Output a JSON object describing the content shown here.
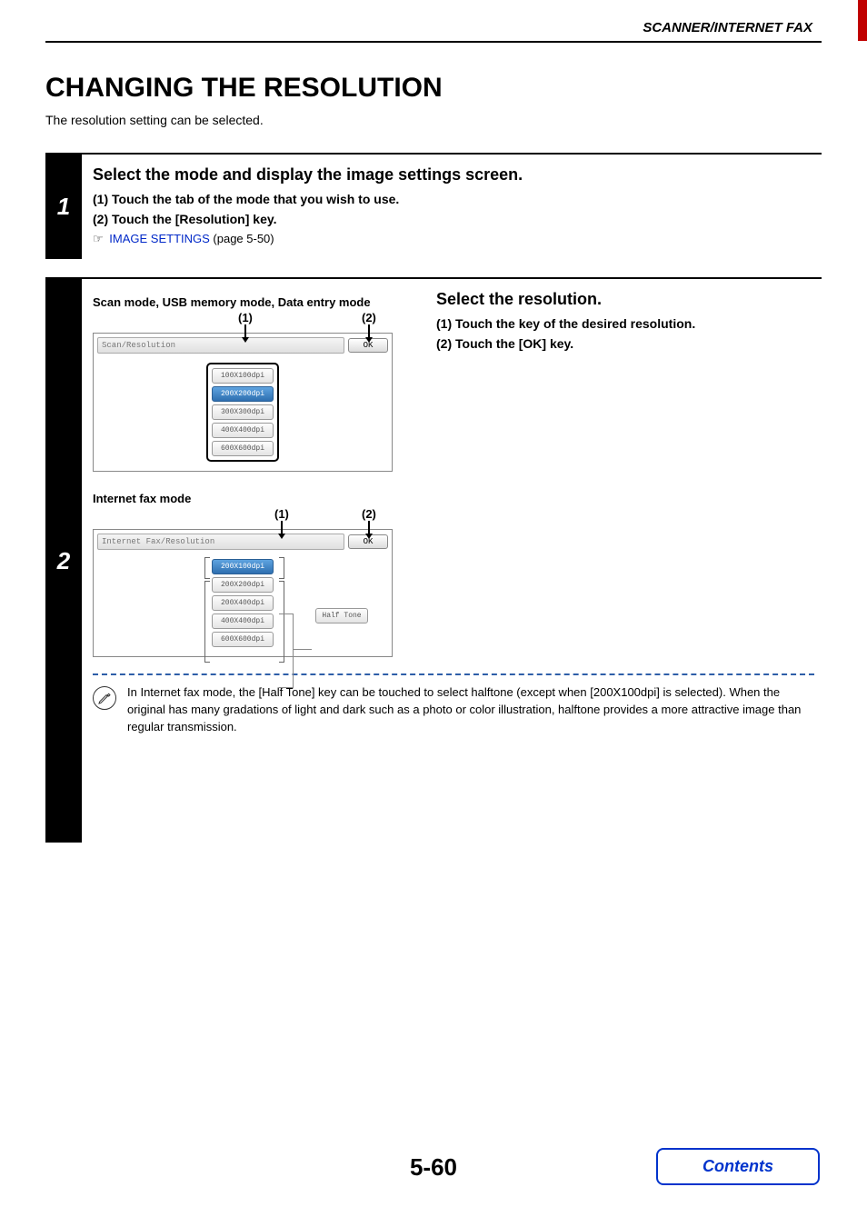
{
  "header": {
    "section": "SCANNER/INTERNET FAX"
  },
  "title": "CHANGING THE RESOLUTION",
  "intro": "The resolution setting can be selected.",
  "step1": {
    "num": "1",
    "title": "Select the mode and display the image settings screen.",
    "sub1": "(1)  Touch the tab of the mode that you wish to use.",
    "sub2": "(2)  Touch the [Resolution] key.",
    "pointer": "☞",
    "link": "IMAGE SETTINGS",
    "link_after": " (page 5-50)"
  },
  "step2": {
    "num": "2",
    "right_title": "Select the resolution.",
    "right_sub1": "(1)  Touch the key of the desired resolution.",
    "right_sub2": "(2)  Touch the [OK] key.",
    "scan": {
      "heading": "Scan mode, USB memory mode, Data entry mode",
      "c1": "(1)",
      "c2": "(2)",
      "panel_title": "Scan/Resolution",
      "ok": "OK",
      "options": [
        "100X100dpi",
        "200X200dpi",
        "300X300dpi",
        "400X400dpi",
        "600X600dpi"
      ],
      "selected_index": 1
    },
    "ifax": {
      "heading": "Internet fax mode",
      "c1": "(1)",
      "c2": "(2)",
      "panel_title": "Internet Fax/Resolution",
      "ok": "OK",
      "options": [
        "200X100dpi",
        "200X200dpi",
        "200X400dpi",
        "400X400dpi",
        "600X600dpi"
      ],
      "selected_index": 0,
      "halftone": "Half Tone"
    },
    "note": "In Internet fax mode, the [Half Tone] key can be touched to select halftone (except when [200X100dpi] is selected). When the original has many gradations of light and dark such as a photo or color illustration, halftone provides a more attractive image than regular transmission."
  },
  "page_number": "5-60",
  "contents": "Contents"
}
